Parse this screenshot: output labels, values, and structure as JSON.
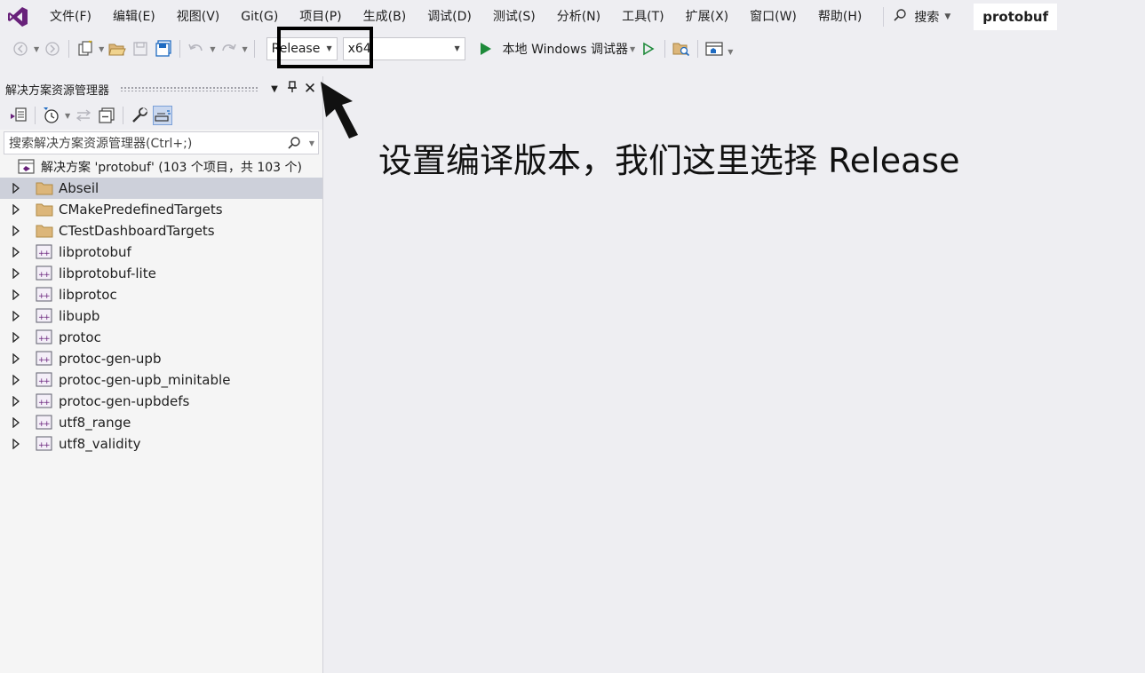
{
  "menubar": {
    "items": [
      "文件(F)",
      "编辑(E)",
      "视图(V)",
      "Git(G)",
      "项目(P)",
      "生成(B)",
      "调试(D)",
      "测试(S)",
      "分析(N)",
      "工具(T)",
      "扩展(X)",
      "窗口(W)",
      "帮助(H)"
    ],
    "search_label": "搜索",
    "project_name": "protobuf"
  },
  "toolbar": {
    "config_value": "Release",
    "platform_value": "x64",
    "run_label": "本地 Windows 调试器"
  },
  "explorer": {
    "title": "解决方案资源管理器",
    "search_placeholder": "搜索解决方案资源管理器(Ctrl+;)",
    "solution_label": "解决方案 'protobuf' (103 个项目，共 103 个)",
    "items": [
      {
        "label": "Abseil",
        "icon": "folder-icon"
      },
      {
        "label": "CMakePredefinedTargets",
        "icon": "folder-icon"
      },
      {
        "label": "CTestDashboardTargets",
        "icon": "folder-icon"
      },
      {
        "label": "libprotobuf",
        "icon": "cpp-project-icon"
      },
      {
        "label": "libprotobuf-lite",
        "icon": "cpp-project-icon"
      },
      {
        "label": "libprotoc",
        "icon": "cpp-project-icon"
      },
      {
        "label": "libupb",
        "icon": "cpp-project-icon"
      },
      {
        "label": "protoc",
        "icon": "cpp-project-icon"
      },
      {
        "label": "protoc-gen-upb",
        "icon": "cpp-project-icon"
      },
      {
        "label": "protoc-gen-upb_minitable",
        "icon": "cpp-project-icon"
      },
      {
        "label": "protoc-gen-upbdefs",
        "icon": "cpp-project-icon"
      },
      {
        "label": "utf8_range",
        "icon": "cpp-project-icon"
      },
      {
        "label": "utf8_validity",
        "icon": "cpp-project-icon"
      }
    ]
  },
  "annotation": {
    "text": "设置编译版本，我们这里选择 Release"
  },
  "colors": {
    "accent_purple": "#68217a",
    "run_green": "#1e8a3a",
    "folder_yellow": "#dcb67a",
    "selected_row": "#cdd0da"
  }
}
